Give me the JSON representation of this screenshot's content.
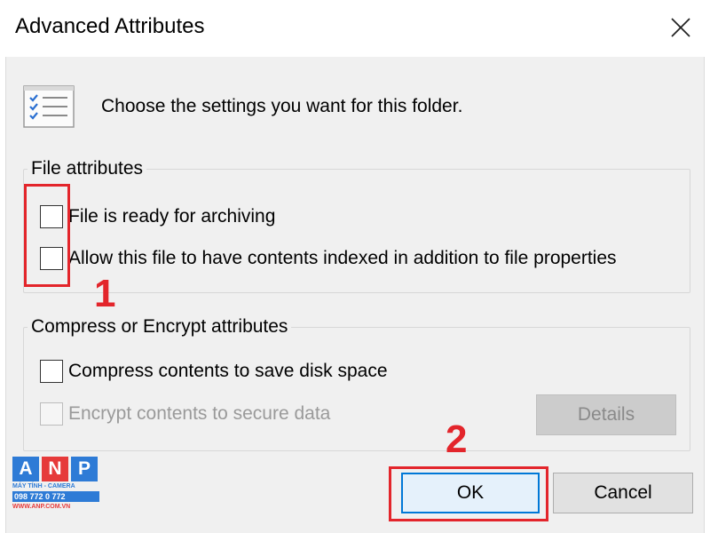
{
  "window": {
    "title": "Advanced Attributes",
    "close_icon": "close-icon"
  },
  "header": {
    "icon": "checklist-icon",
    "text": "Choose the settings you want for this folder."
  },
  "file_attributes": {
    "legend": "File attributes",
    "items": [
      {
        "label": "File is ready for archiving",
        "checked": false,
        "enabled": true
      },
      {
        "label": "Allow this file to have contents indexed in addition to file properties",
        "checked": false,
        "enabled": true
      }
    ]
  },
  "compress_encrypt": {
    "legend": "Compress or Encrypt attributes",
    "items": [
      {
        "label": "Compress contents to save disk space",
        "checked": false,
        "enabled": true
      },
      {
        "label": "Encrypt contents to secure data",
        "checked": false,
        "enabled": false
      }
    ],
    "details_label": "Details"
  },
  "buttons": {
    "ok": "OK",
    "cancel": "Cancel"
  },
  "annotations": {
    "step1": "1",
    "step2": "2",
    "highlight_color": "#e3252b"
  },
  "watermark": {
    "letters": [
      "A",
      "N",
      "P"
    ],
    "letter_colors": [
      "#2e7bd6",
      "#e63a3a",
      "#2e7bd6"
    ],
    "line1": "MÁY TÍNH - CAMERA",
    "line2": "098 772 0 772",
    "line3": "WWW.ANP.COM.VN"
  }
}
